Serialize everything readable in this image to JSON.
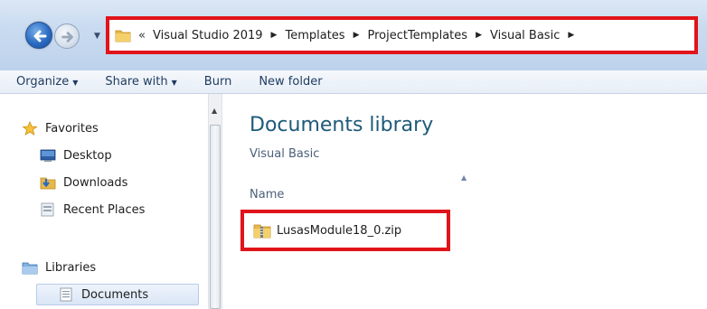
{
  "address_bar": {
    "overflow_glyph": "«",
    "crumbs": [
      "Visual Studio 2019",
      "Templates",
      "ProjectTemplates",
      "Visual Basic"
    ]
  },
  "toolbar": {
    "organize": "Organize",
    "share_with": "Share with",
    "burn": "Burn",
    "new_folder": "New folder"
  },
  "nav_pane": {
    "favorites": "Favorites",
    "desktop": "Desktop",
    "downloads": "Downloads",
    "recent_places": "Recent Places",
    "libraries": "Libraries",
    "documents": "Documents"
  },
  "content": {
    "title": "Documents library",
    "subtitle": "Visual Basic",
    "column_name": "Name",
    "files": [
      {
        "name": "LusasModule18_0.zip",
        "icon": "zip-folder-icon"
      }
    ]
  },
  "colors": {
    "highlight_border": "#e0141a",
    "library_title": "#1e5a7a",
    "toolbar_text": "#1e3a5f"
  }
}
